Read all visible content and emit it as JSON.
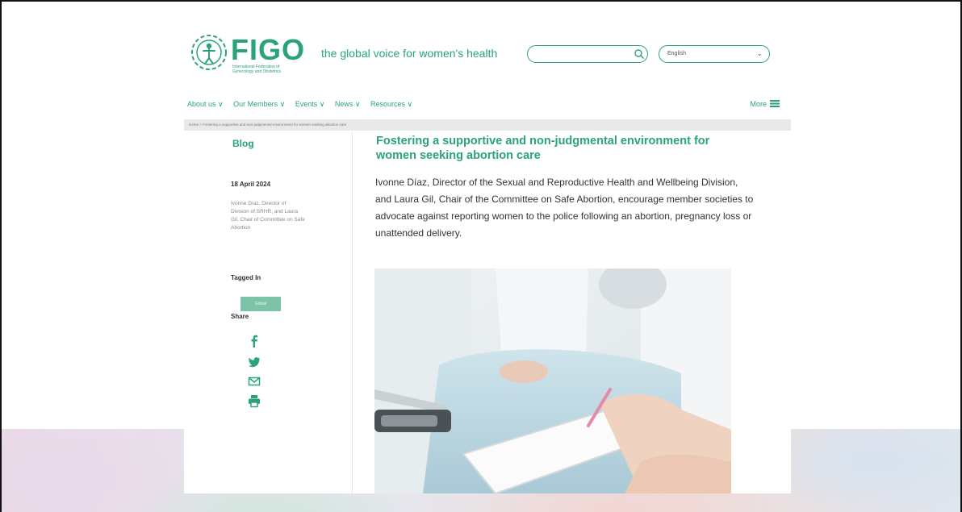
{
  "header": {
    "logo_word": "FIGO",
    "logo_subtitle": "International Federation of Gynecology and Obstetrics",
    "tagline": "the global voice for women's health",
    "search_placeholder": "",
    "language": "English"
  },
  "nav": {
    "items": [
      "About us",
      "Our Members",
      "Events",
      "News",
      "Resources"
    ],
    "more": "More"
  },
  "breadcrumb": "Home  >  Fostering a supportive and non-judgmental environment for women seeking abortion care",
  "sidebar": {
    "title": "Blog",
    "date": "18 April 2024",
    "authors": "Ivonne Díaz, Director of Division of SRHR, and Laura Gil, Chair of Committee on Safe Abortion",
    "tagged_label": "Tagged In",
    "tag": "Global",
    "share_label": "Share",
    "share_icons": [
      "facebook-icon",
      "twitter-icon",
      "mail-icon",
      "print-icon"
    ]
  },
  "article": {
    "title": "Fostering a supportive and non-judgmental environment for women seeking abortion care",
    "intro": "Ivonne Díaz, Director of the Sexual and Reproductive Health and Wellbeing Division, and Laura Gil, Chair of the Committee on Safe Abortion, encourage member societies to advocate against reporting women to the police following an abortion, pregnancy loss or unattended delivery."
  },
  "colors": {
    "brand": "#2aa37a",
    "tag_bg": "#7cc3a8",
    "crumb_bg": "#e8eaea"
  }
}
